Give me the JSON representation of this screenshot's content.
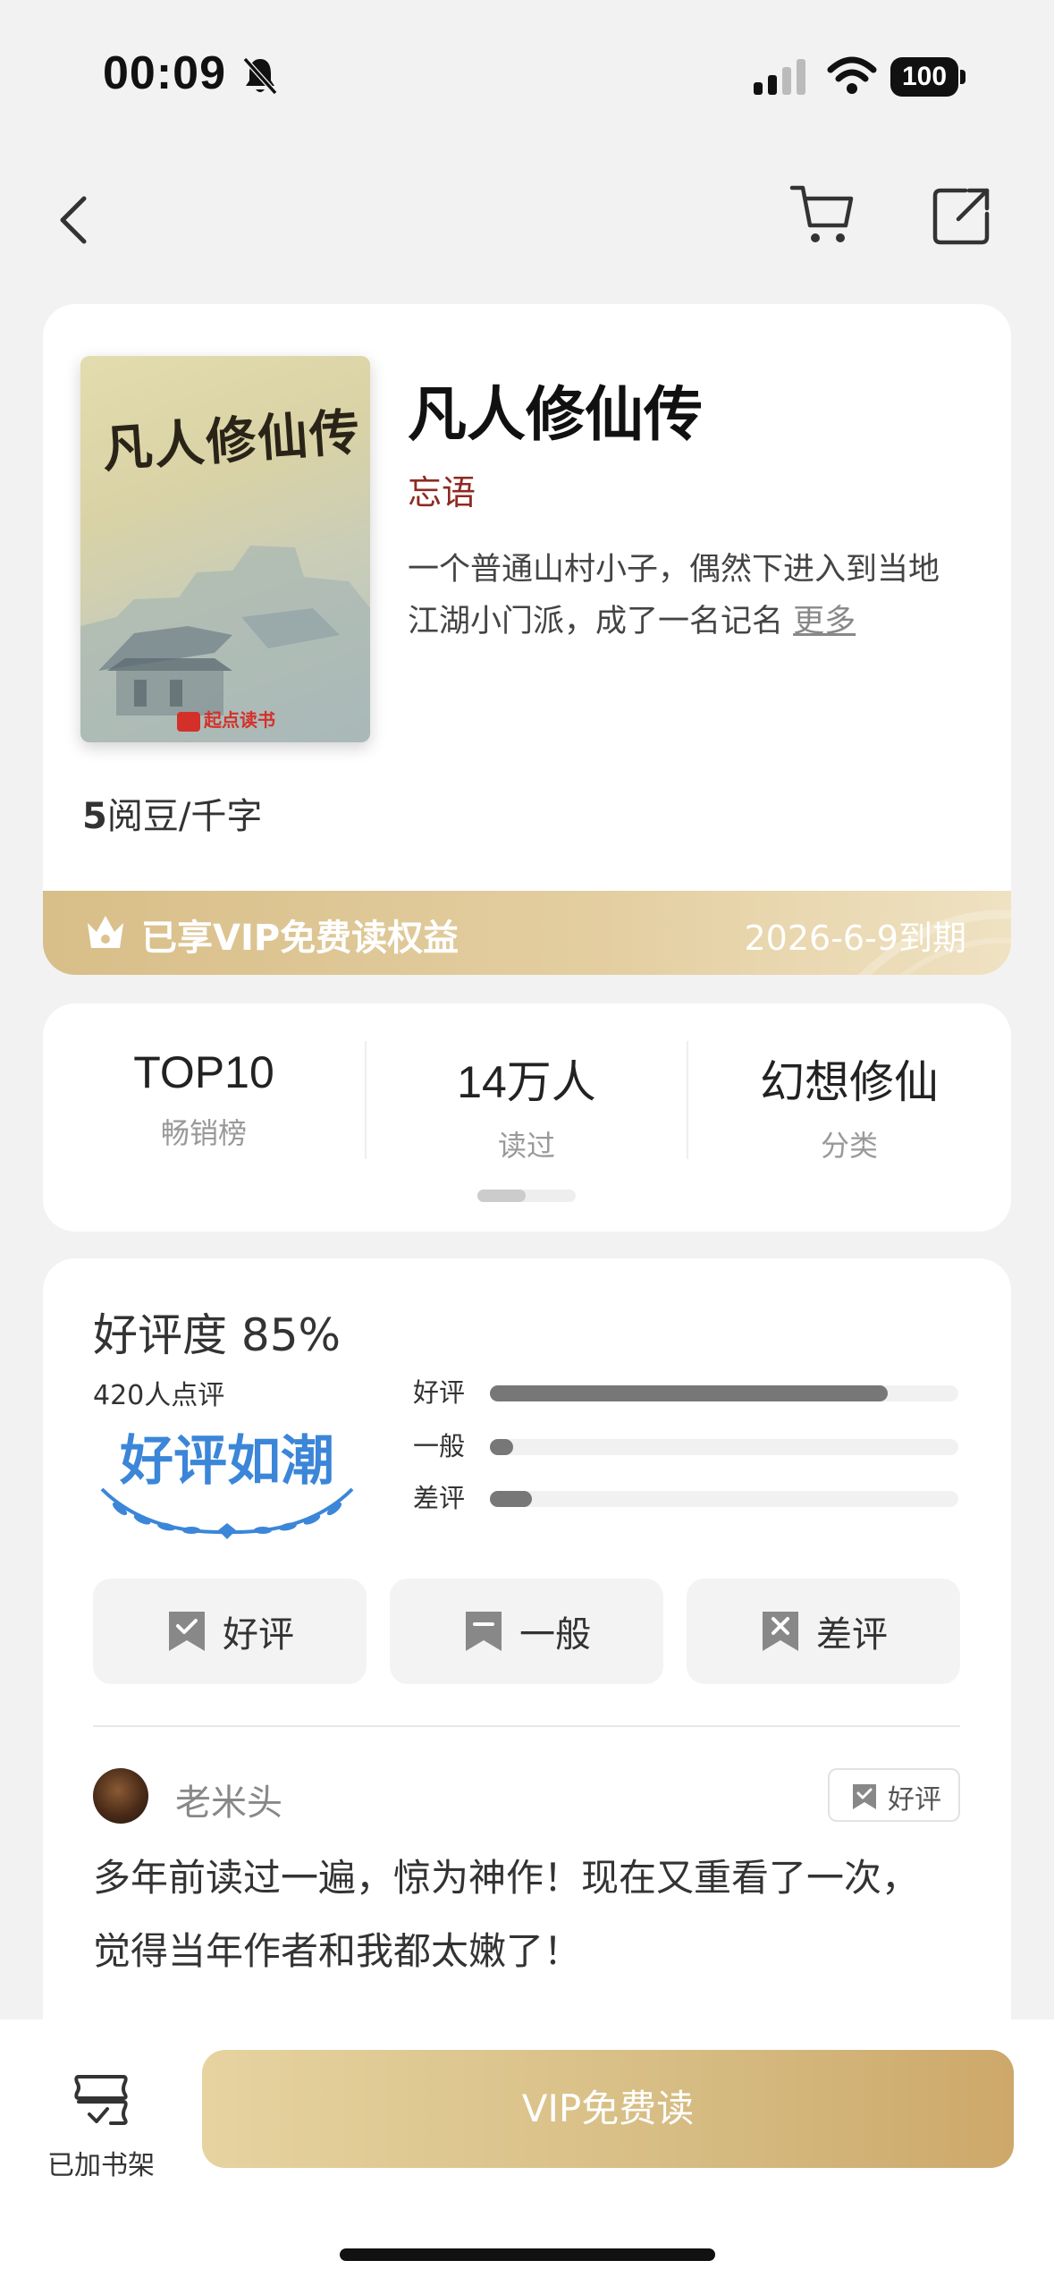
{
  "status_bar": {
    "time": "00:09",
    "battery": "100"
  },
  "book": {
    "cover_title": "凡人修仙传",
    "cover_brand": "起点读书",
    "title": "凡人修仙传",
    "author": "忘语",
    "description": "一个普通山村小子，偶然下进入到当地江湖小门派，成了一名记名",
    "more": "更多",
    "price_amount": "5",
    "price_unit": "阅豆/千字"
  },
  "vip": {
    "text": "已享VIP免费读权益",
    "expire": "2026-6-9到期"
  },
  "stats": [
    {
      "value": "TOP10",
      "label": "畅销榜"
    },
    {
      "value": "14万人",
      "label": "读过"
    },
    {
      "value": "幻想修仙",
      "label": "分类"
    }
  ],
  "rating": {
    "title": "好评度 85%",
    "review_count": "420人点评",
    "badge": "好评如潮",
    "bars": [
      {
        "label": "好评",
        "fraction": 0.85
      },
      {
        "label": "一般",
        "fraction": 0.05
      },
      {
        "label": "差评",
        "fraction": 0.09
      }
    ],
    "buttons": {
      "good": "好评",
      "neutral": "一般",
      "bad": "差评"
    }
  },
  "review": {
    "user": "老米头",
    "tag": "好评",
    "text": "多年前读过一遍，惊为神作！现在又重看了一次，觉得当年作者和我都太嫩了！"
  },
  "bottom": {
    "shelf_label": "已加书架",
    "read_button": "VIP免费读"
  },
  "colors": {
    "gold": "#d6bc82",
    "author": "#8f2a22",
    "badge_blue": "#3b86d8"
  }
}
